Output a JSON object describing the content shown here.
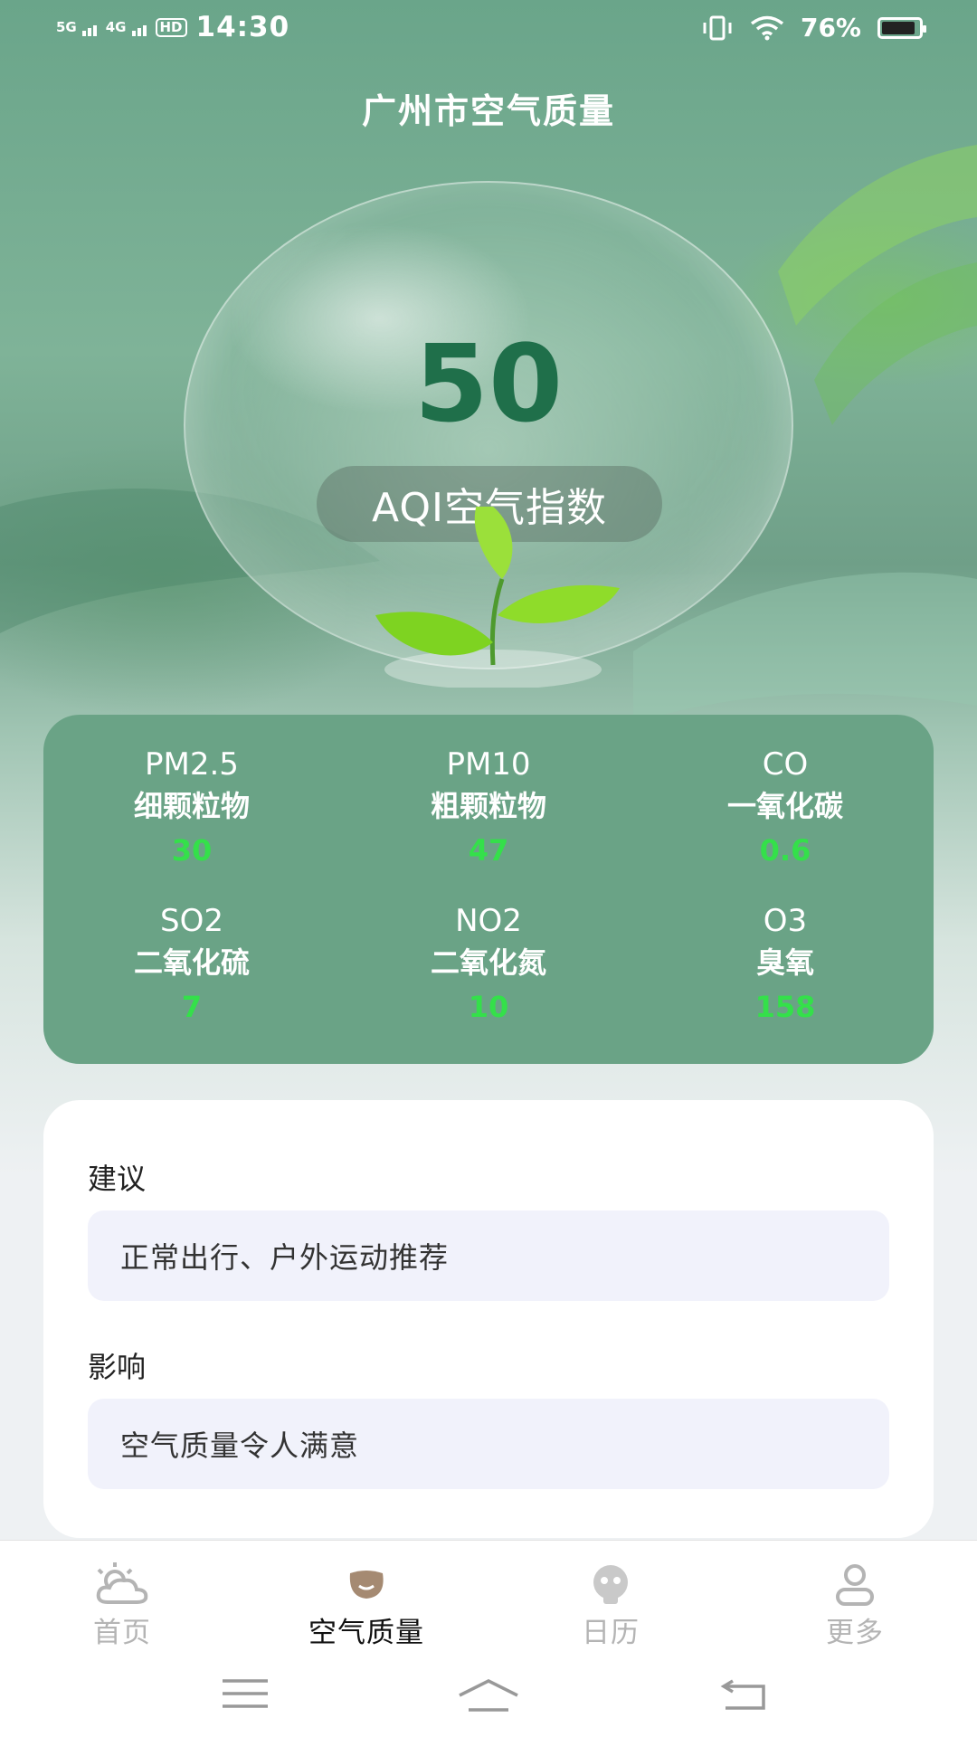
{
  "status_bar": {
    "net1": "5G",
    "net2": "4G",
    "hd": "HD",
    "time": "14:30",
    "battery": "76%",
    "icons": [
      "vibrate-icon",
      "wifi-icon",
      "battery-icon"
    ]
  },
  "page": {
    "title": "广州市空气质量"
  },
  "aqi": {
    "value": "50",
    "label": "AQI空气指数"
  },
  "pollutants": [
    {
      "code": "PM2.5",
      "name": "细颗粒物",
      "value": "30"
    },
    {
      "code": "PM10",
      "name": "粗颗粒物",
      "value": "47"
    },
    {
      "code": "CO",
      "name": "一氧化碳",
      "value": "0.6"
    },
    {
      "code": "SO2",
      "name": "二氧化硫",
      "value": "7"
    },
    {
      "code": "NO2",
      "name": "二氧化氮",
      "value": "10"
    },
    {
      "code": "O3",
      "name": "臭氧",
      "value": "158"
    }
  ],
  "advice": {
    "suggest_label": "建议",
    "suggest_text": "正常出行、户外运动推荐",
    "impact_label": "影响",
    "impact_text": "空气质量令人满意"
  },
  "tabs": [
    {
      "label": "首页",
      "icon": "weather-icon",
      "active": false
    },
    {
      "label": "空气质量",
      "icon": "air-quality-icon",
      "active": true
    },
    {
      "label": "日历",
      "icon": "calendar-icon",
      "active": false
    },
    {
      "label": "更多",
      "icon": "person-icon",
      "active": false
    }
  ],
  "colors": {
    "theme_green": "#6aa386",
    "aqi_value": "#1f6f4a",
    "pollutant_value": "#34e04a"
  }
}
